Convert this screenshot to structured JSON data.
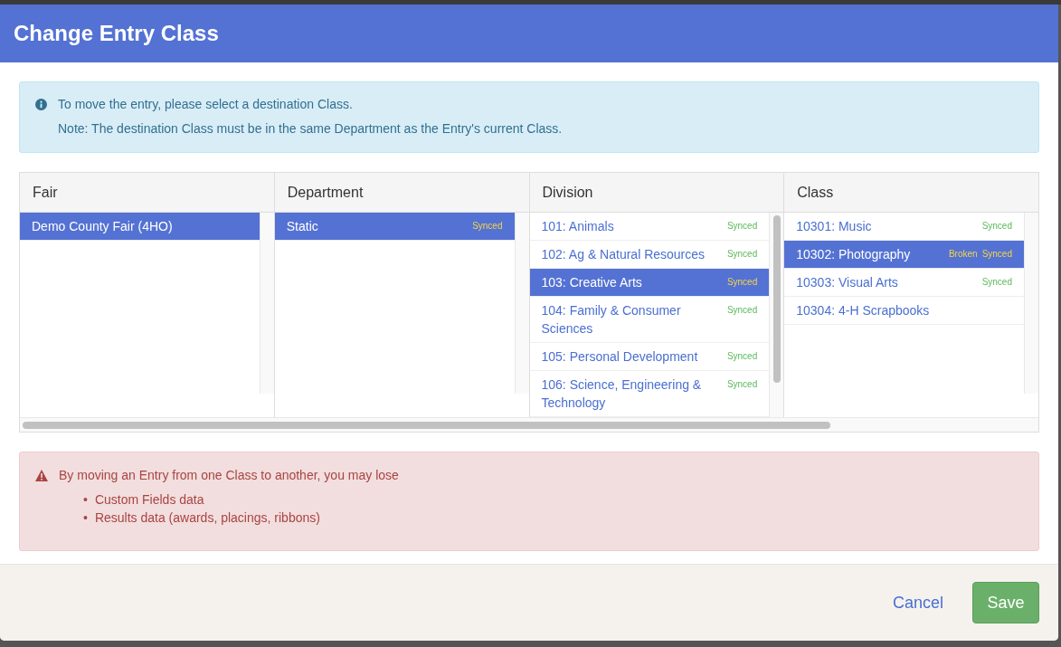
{
  "dialog": {
    "title": "Change Entry Class"
  },
  "info_alert": {
    "lines": [
      "To move the entry, please select a destination Class.",
      "Note: The destination Class must be in the same Department as the Entry's current Class."
    ]
  },
  "columns": [
    {
      "heading": "Fair",
      "items": [
        {
          "label": "Demo County Fair (4HO)",
          "selected": true
        }
      ]
    },
    {
      "heading": "Department",
      "items": [
        {
          "label": "Static",
          "selected": true,
          "tags": [
            "Synced"
          ]
        }
      ]
    },
    {
      "heading": "Division",
      "scrollbar": true,
      "items": [
        {
          "label": "101: Animals",
          "selected": false,
          "tags": [
            "Synced"
          ]
        },
        {
          "label": "102: Ag & Natural Resources",
          "selected": false,
          "tags": [
            "Synced"
          ]
        },
        {
          "label": "103: Creative Arts",
          "selected": true,
          "tags": [
            "Synced"
          ]
        },
        {
          "label": "104: Family & Consumer Sciences",
          "selected": false,
          "tags": [
            "Synced"
          ]
        },
        {
          "label": "105: Personal Development",
          "selected": false,
          "tags": [
            "Synced"
          ]
        },
        {
          "label": "106: Science, Engineering & Technology",
          "selected": false,
          "tags": [
            "Synced"
          ]
        }
      ]
    },
    {
      "heading": "Class",
      "items": [
        {
          "label": "10301: Music",
          "selected": false,
          "tags": [
            "Synced"
          ]
        },
        {
          "label": "10302: Photography",
          "selected": true,
          "tags": [
            "Broken",
            "Synced"
          ]
        },
        {
          "label": "10303: Visual Arts",
          "selected": false,
          "tags": [
            "Synced"
          ]
        },
        {
          "label": "10304: 4-H Scrapbooks",
          "selected": false
        }
      ]
    }
  ],
  "warning_alert": {
    "text": "By moving an Entry from one Class to another, you may lose",
    "bullets": [
      {
        "marker": "•",
        "text": "Custom Fields data"
      },
      {
        "marker": "•",
        "text": "Results data (awards, placings, ribbons)"
      }
    ]
  },
  "footer": {
    "cancel": "Cancel",
    "save": "Save"
  }
}
